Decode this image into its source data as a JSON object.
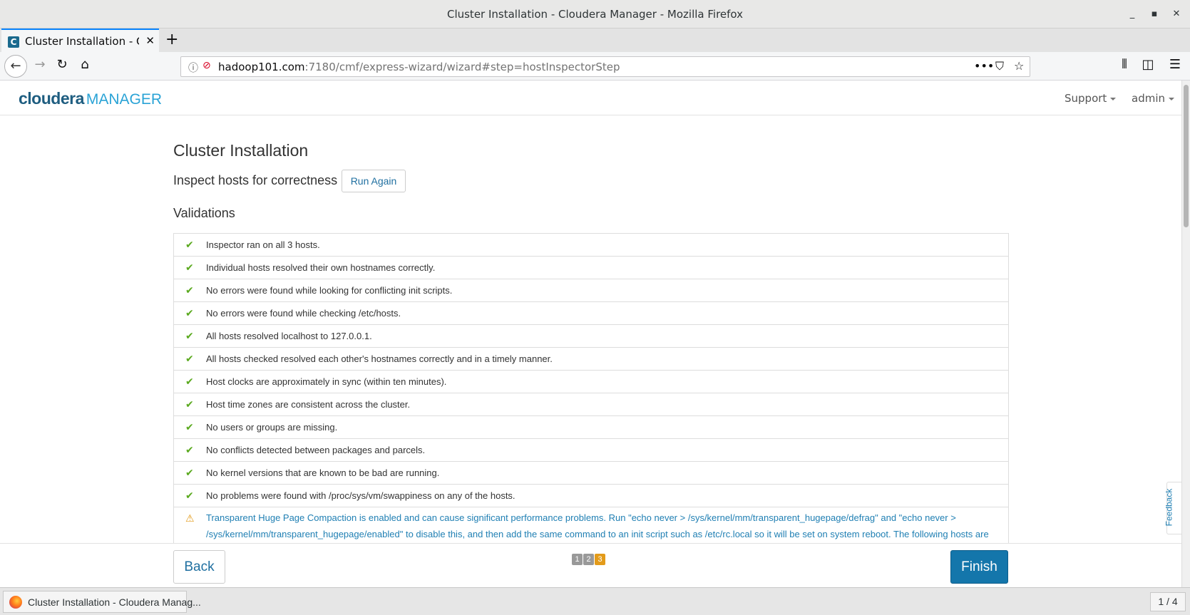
{
  "window": {
    "title": "Cluster Installation - Cloudera Manager - Mozilla Firefox"
  },
  "browser": {
    "tab_title": "Cluster Installation - Cloudera Manager",
    "tab_favicon": "C",
    "url_host": "hadoop101.com",
    "url_rest": ":7180/cmf/express-wizard/wizard#step=hostInspectorStep"
  },
  "header": {
    "logo_main": "cloudera",
    "logo_sub": "MANAGER",
    "support_label": "Support",
    "user_label": "admin"
  },
  "main": {
    "title": "Cluster Installation",
    "subtitle": "Inspect hosts for correctness",
    "run_again_label": "Run Again",
    "validations_heading": "Validations",
    "validations": [
      {
        "status": "ok",
        "text": "Inspector ran on all 3 hosts."
      },
      {
        "status": "ok",
        "text": "Individual hosts resolved their own hostnames correctly."
      },
      {
        "status": "ok",
        "text": "No errors were found while looking for conflicting init scripts."
      },
      {
        "status": "ok",
        "text": "No errors were found while checking /etc/hosts."
      },
      {
        "status": "ok",
        "text": "All hosts resolved localhost to 127.0.0.1."
      },
      {
        "status": "ok",
        "text": "All hosts checked resolved each other's hostnames correctly and in a timely manner."
      },
      {
        "status": "ok",
        "text": "Host clocks are approximately in sync (within ten minutes)."
      },
      {
        "status": "ok",
        "text": "Host time zones are consistent across the cluster."
      },
      {
        "status": "ok",
        "text": "No users or groups are missing."
      },
      {
        "status": "ok",
        "text": "No conflicts detected between packages and parcels."
      },
      {
        "status": "ok",
        "text": "No kernel versions that are known to be bad are running."
      },
      {
        "status": "ok",
        "text": "No problems were found with /proc/sys/vm/swappiness on any of the hosts."
      },
      {
        "status": "warning",
        "text": "Transparent Huge Page Compaction is enabled and can cause significant performance problems. Run \"echo never > /sys/kernel/mm/transparent_hugepage/defrag\" and \"echo never > /sys/kernel/mm/transparent_hugepage/enabled\" to disable this, and then add the same command to an init script such as /etc/rc.local so it will be set on system reboot. The following hosts are affected: ›"
      }
    ]
  },
  "footer": {
    "back_label": "Back",
    "finish_label": "Finish",
    "steps": [
      "1",
      "2",
      "3"
    ],
    "active_step": "3"
  },
  "feedback_label": "Feedback",
  "taskbar": {
    "item_label": "Cluster Installation - Cloudera Manag...",
    "page_counter": "1 / 4"
  },
  "colors": {
    "accent": "#1476ab",
    "ok": "#5aa91e",
    "warning": "#e39b1a",
    "link": "#1f7fb3"
  }
}
